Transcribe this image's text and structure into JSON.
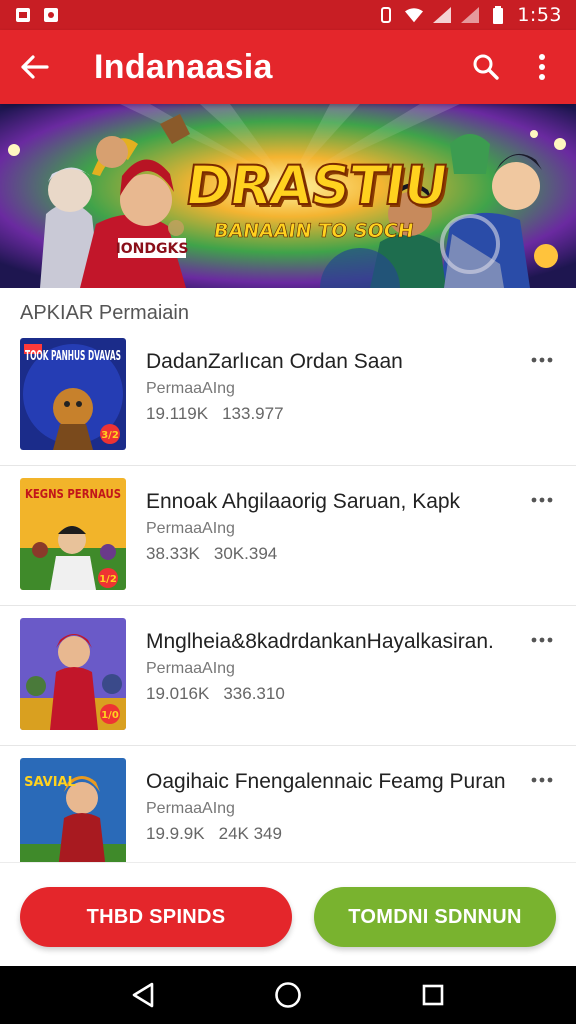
{
  "status_bar": {
    "time": "1:53",
    "icons": [
      "gallery-icon",
      "chrome-icon",
      "vibrate-icon",
      "wifi-icon",
      "signal-icon",
      "signal-icon",
      "battery-icon"
    ]
  },
  "app_bar": {
    "title": "Indanaasia",
    "icons": [
      "arrow-back-icon",
      "search-icon",
      "more-vert-icon"
    ]
  },
  "banner": {
    "title": "DRASTIU",
    "subtitle": "BANAAIN TO SOCH",
    "jersey_text": "IONDGKS"
  },
  "section": {
    "title": "APKIAR Permaiain"
  },
  "items": [
    {
      "title": "DadanZarlıcan Ordan Saan",
      "subtitle": "PermaaAIng",
      "stat1": "19.119K",
      "stat2": "133.977",
      "thumb_text": "TOOK PANHUS DVAVAS",
      "thumb_badge": "3/2"
    },
    {
      "title": "Ennoak Ahgilaaorig Saruan, Kapk",
      "subtitle": "PermaaAIng",
      "stat1": "38.33K",
      "stat2": "30K.394",
      "thumb_text": "KEGNS PERNAUS",
      "thumb_badge": "1/2"
    },
    {
      "title": "Mnglheia&8kadrdankanHayalkasiran.",
      "subtitle": "PermaaAIng",
      "stat1": "19.016K",
      "stat2": "336.310",
      "thumb_text": "",
      "thumb_badge": "1/0"
    },
    {
      "title": "Oagihaic Fnengalennaic Feamg Puran",
      "subtitle": "PermaaAIng",
      "stat1": "19.9.9K",
      "stat2": "24K 349",
      "thumb_text": "SAVIAL",
      "thumb_badge": ""
    }
  ],
  "buttons": {
    "primary": "THBD SPINDS",
    "secondary": "TOMDNI SDNNUN"
  },
  "nav": {
    "icons": [
      "back-triangle-icon",
      "home-circle-icon",
      "recents-square-icon"
    ]
  },
  "colors": {
    "status_bar": "#c81e24",
    "app_bar": "#e4262b",
    "primary_button": "#e4262b",
    "secondary_button": "#79b32f",
    "banner_title": "#ffd21f"
  }
}
